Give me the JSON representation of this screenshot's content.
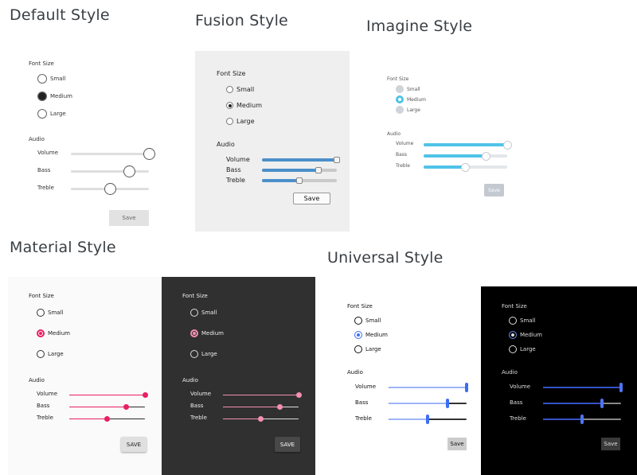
{
  "titles": {
    "default": "Default Style",
    "fusion": "Fusion Style",
    "imagine": "Imagine Style",
    "material": "Material Style",
    "universal": "Universal Style"
  },
  "form": {
    "font_size_label": "Font Size",
    "options": [
      "Small",
      "Medium",
      "Large"
    ],
    "selected": "Medium",
    "audio_label": "Audio",
    "sliders": [
      {
        "label": "Volume",
        "value": 1.0
      },
      {
        "label": "Bass",
        "value": 0.75
      },
      {
        "label": "Treble",
        "value": 0.5
      }
    ]
  },
  "save_labels": {
    "default": "Save",
    "fusion": "Save",
    "imagine": "Save",
    "material": "SAVE",
    "universal": "Save"
  },
  "colors": {
    "material_accent": "#e91e63",
    "universal_accent": "#3d6ff2",
    "imagine_accent": "#4fc3e8",
    "fusion_accent": "#4b8fc9"
  }
}
